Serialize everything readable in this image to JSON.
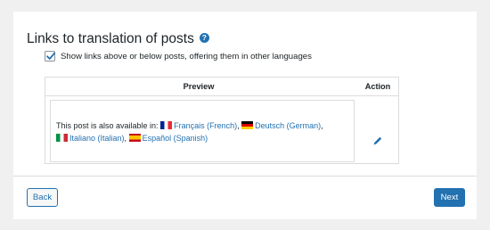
{
  "section": {
    "title": "Links to translation of posts",
    "help_icon": "question-circle-icon"
  },
  "option": {
    "checked": true,
    "label": "Show links above or below posts, offering them in other languages"
  },
  "table": {
    "headers": [
      "Preview",
      "Action"
    ],
    "preview_intro": "This post is also available in:",
    "languages": [
      {
        "label": "Français (French)",
        "flag": "fr"
      },
      {
        "label": "Deutsch (German)",
        "flag": "de"
      },
      {
        "label": "Italiano (Italian)",
        "flag": "it"
      },
      {
        "label": "Español (Spanish)",
        "flag": "es"
      }
    ],
    "separator": ",",
    "action_icon": "pencil-icon"
  },
  "nav": {
    "back_label": "Back",
    "next_label": "Next"
  },
  "colors": {
    "accent": "#2271b1",
    "background": "#f0f0f1",
    "card": "#ffffff",
    "border": "#dcdcde"
  }
}
